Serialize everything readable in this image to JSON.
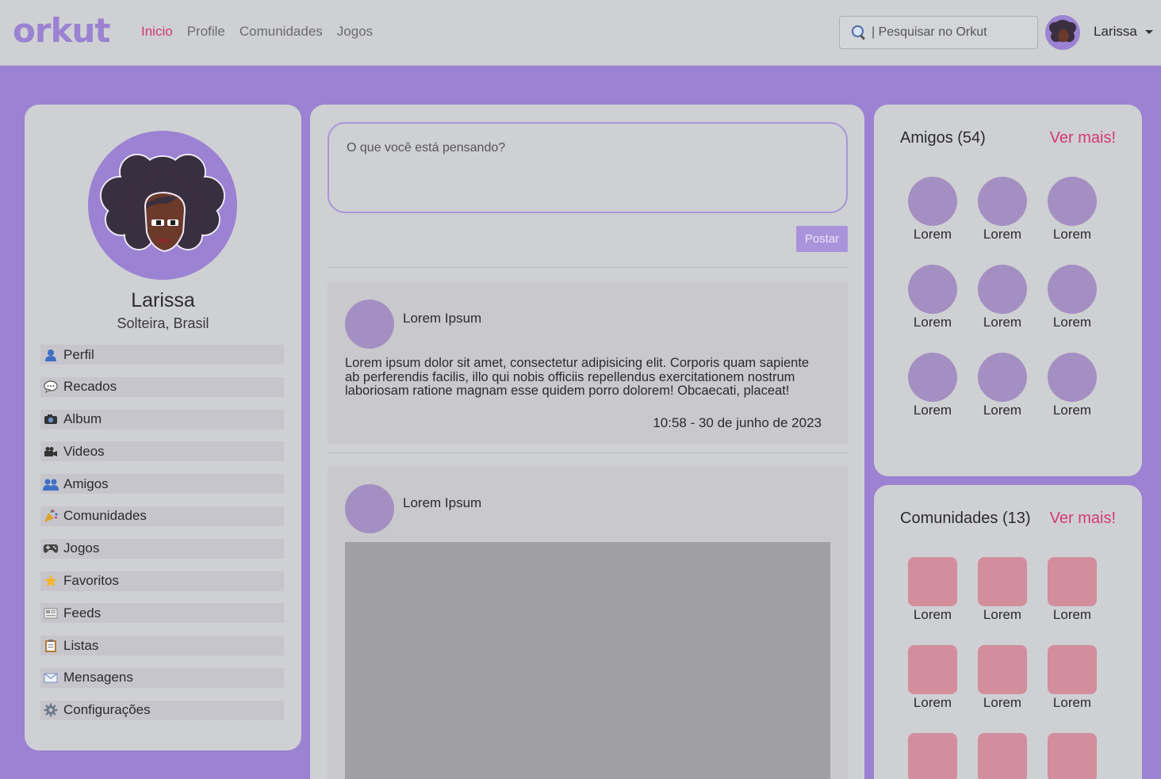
{
  "navbar": {
    "logo": "orkut",
    "links": [
      "Inicio",
      "Profile",
      "Comunidades",
      "Jogos"
    ],
    "active_link": "Inicio",
    "search_placeholder": "| Pesquisar no Orkut",
    "user_name": "Larissa"
  },
  "profile": {
    "name": "Larissa",
    "status": "Solteira, Brasil",
    "menu": [
      {
        "icon": "person-icon",
        "label": "Perfil"
      },
      {
        "icon": "speech-bubble-icon",
        "label": "Recados"
      },
      {
        "icon": "camera-icon",
        "label": "Album"
      },
      {
        "icon": "video-camera-icon",
        "label": "Videos"
      },
      {
        "icon": "people-icon",
        "label": "Amigos"
      },
      {
        "icon": "party-popper-icon",
        "label": "Comunidades"
      },
      {
        "icon": "gamepad-icon",
        "label": "Jogos"
      },
      {
        "icon": "star-icon",
        "label": "Favoritos"
      },
      {
        "icon": "newspaper-icon",
        "label": "Feeds"
      },
      {
        "icon": "clipboard-icon",
        "label": "Listas"
      },
      {
        "icon": "envelope-icon",
        "label": "Mensagens"
      },
      {
        "icon": "gear-icon",
        "label": "Configurações"
      }
    ]
  },
  "feed": {
    "composer_placeholder": "O que você está pensando?",
    "post_button": "Postar",
    "posts": [
      {
        "author": "Lorem Ipsum",
        "text": "Lorem ipsum dolor sit amet, consectetur adipisicing elit. Corporis quam sapiente ab perferendis facilis, illo qui nobis officiis repellendus exercitationem nostrum laboriosam ratione magnam esse quidem porro dolorem! Obcaecati, placeat!",
        "time": "10:58 - 30 de junho de 2023"
      },
      {
        "author": "Lorem Ipsum"
      }
    ]
  },
  "friends": {
    "title": "Amigos (54)",
    "more": "Ver mais!",
    "items": [
      "Lorem",
      "Lorem",
      "Lorem",
      "Lorem",
      "Lorem",
      "Lorem",
      "Lorem",
      "Lorem",
      "Lorem"
    ]
  },
  "communities": {
    "title": "Comunidades (13)",
    "more": "Ver mais!",
    "items": [
      "Lorem",
      "Lorem",
      "Lorem",
      "Lorem",
      "Lorem",
      "Lorem",
      "",
      "",
      ""
    ]
  },
  "colors": {
    "background": "#9b82d2",
    "card": "#cfd0d3",
    "accent": "#d1397a",
    "friend_avatar": "#a38fc2",
    "community_tile": "#d28e9c"
  }
}
